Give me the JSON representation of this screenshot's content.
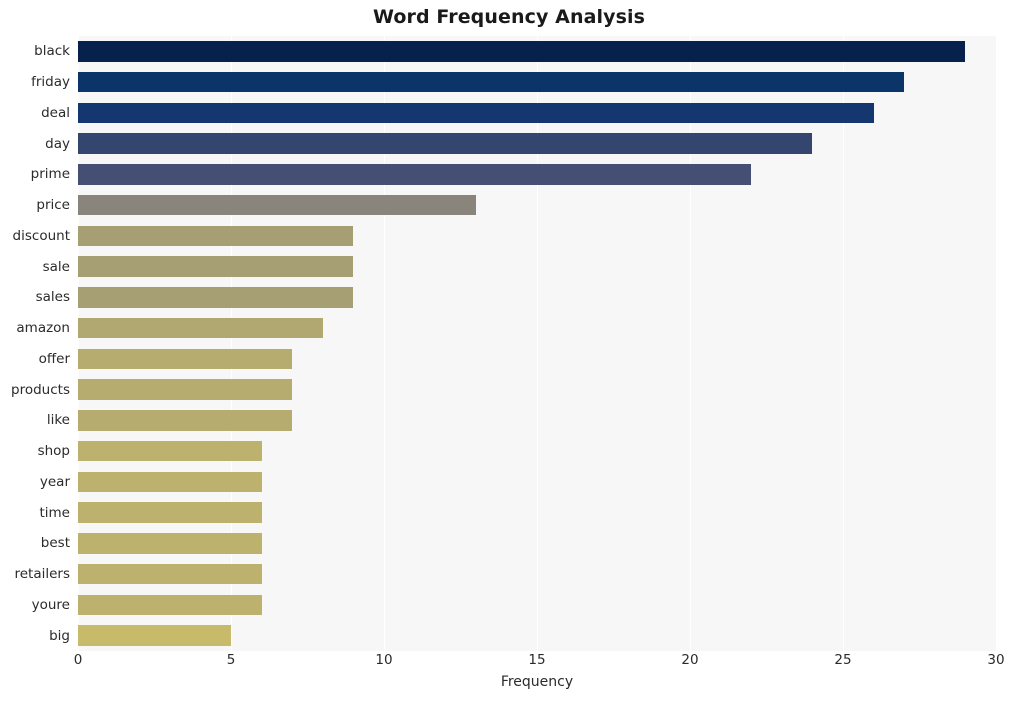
{
  "chart_data": {
    "type": "bar",
    "orientation": "horizontal",
    "title": "Word Frequency Analysis",
    "xlabel": "Frequency",
    "ylabel": "",
    "xlim": [
      0,
      30
    ],
    "xticks": [
      0,
      5,
      10,
      15,
      20,
      25,
      30
    ],
    "grid": true,
    "legend": null,
    "categories": [
      "black",
      "friday",
      "deal",
      "day",
      "prime",
      "price",
      "discount",
      "sale",
      "sales",
      "amazon",
      "offer",
      "products",
      "like",
      "shop",
      "year",
      "time",
      "best",
      "retailers",
      "youre",
      "big"
    ],
    "values": [
      29,
      27,
      26,
      24,
      22,
      13,
      9,
      9,
      9,
      8,
      7,
      7,
      7,
      6,
      6,
      6,
      6,
      6,
      6,
      5
    ],
    "bar_colors": [
      "#06224c",
      "#0b3569",
      "#13376e",
      "#34456f",
      "#454e73",
      "#8a857c",
      "#a79f74",
      "#a79f74",
      "#a79f74",
      "#b0a771",
      "#b6ac70",
      "#b6ac70",
      "#b6ac70",
      "#bdb16e",
      "#bdb16e",
      "#bdb16e",
      "#bdb16e",
      "#bdb16e",
      "#bdb16e",
      "#c7ba6a"
    ],
    "plot_background": "#f7f7f7",
    "gridline_color": "#ffffff"
  }
}
